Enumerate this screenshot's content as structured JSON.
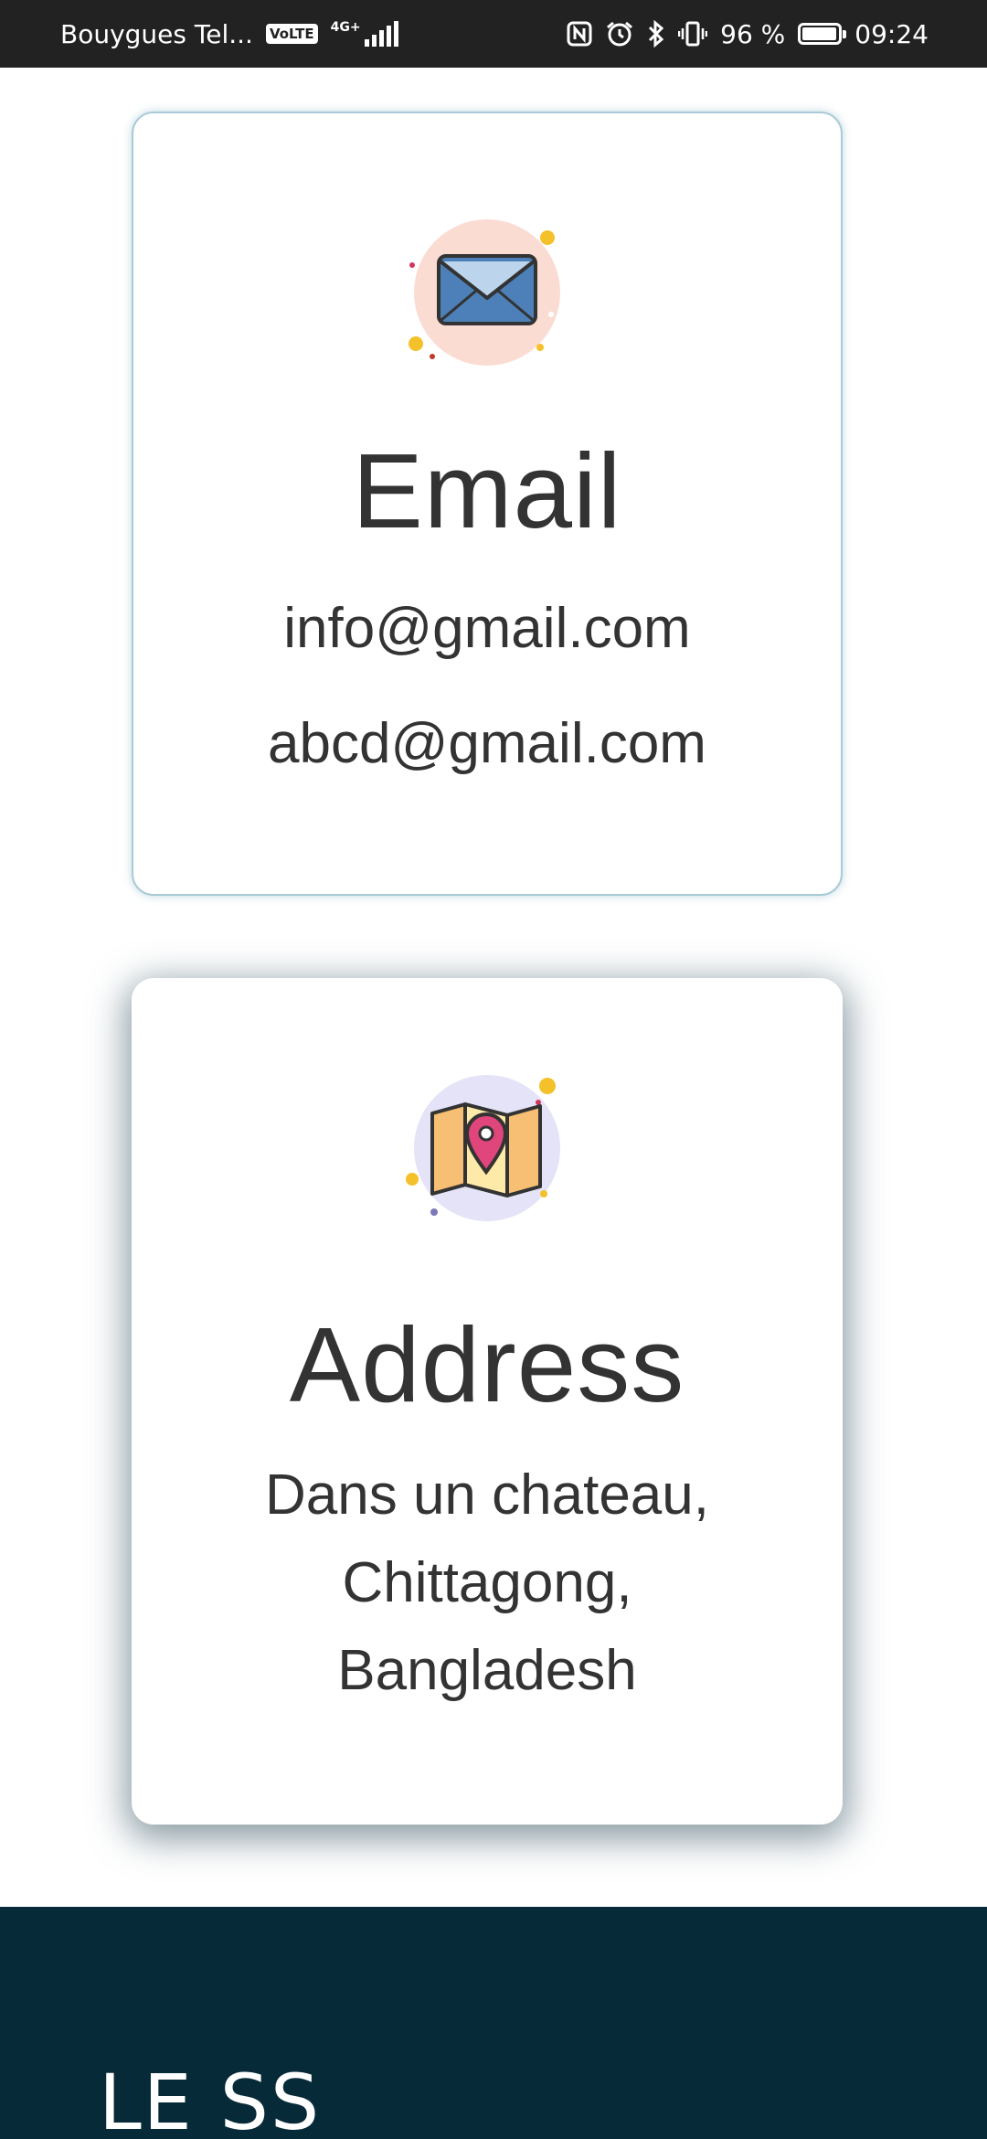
{
  "status_bar": {
    "carrier": "Bouygues Tel...",
    "volte": "VoLTE",
    "network_type": "4G+",
    "battery_percent": "96 %",
    "battery_level": 0.96,
    "time": "09:24",
    "icons": [
      "nfc-icon",
      "alarm-icon",
      "bluetooth-icon",
      "vibrate-icon",
      "battery-icon",
      "signal-icon"
    ]
  },
  "email_card": {
    "icon": "envelope-icon",
    "title": "Email",
    "lines": [
      "info@gmail.com",
      "abcd@gmail.com"
    ]
  },
  "address_card": {
    "icon": "map-pin-icon",
    "title": "Address",
    "lines": [
      "Dans un chateau,",
      "Chittagong,",
      "Bangladesh"
    ]
  },
  "footer": {
    "title": "LE SS"
  },
  "colors": {
    "status_bar_bg": "#222222",
    "text_dark": "#333333",
    "footer_bg": "#072a38",
    "envelope_bg": "#fbdcd3",
    "map_bg": "#e4e3f7"
  }
}
